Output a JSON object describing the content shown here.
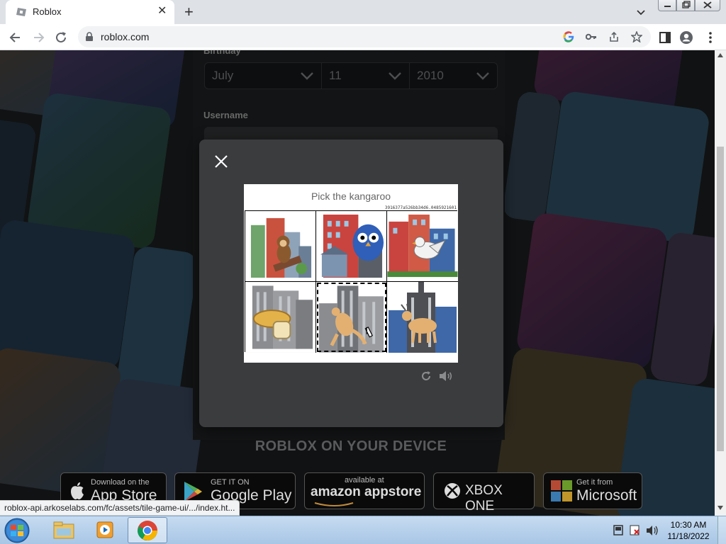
{
  "browser": {
    "tab_title": "Roblox",
    "url": "roblox.com",
    "status_link": "roblox-api.arkoselabs.com/fc/assets/tile-game-ui/.../index.ht..."
  },
  "signup": {
    "birthday_label": "Birthday",
    "birthday_month": "July",
    "birthday_day": "11",
    "birthday_year": "2010",
    "username_label": "Username"
  },
  "captcha": {
    "prompt": "Pick the kangaroo",
    "session_id": "3916377a526bb34d6.0485921601",
    "tiles": [
      {
        "subject": "monkey"
      },
      {
        "subject": "owl"
      },
      {
        "subject": "bird"
      },
      {
        "subject": "bread"
      },
      {
        "subject": "kangaroo",
        "selected": true
      },
      {
        "subject": "goat"
      }
    ]
  },
  "footer": {
    "heading": "ROBLOX ON YOUR DEVICE",
    "apple_small": "Download on the",
    "apple_big": "App Store",
    "google_small": "GET IT ON",
    "google_big": "Google Play",
    "amazon_small": "available at",
    "amazon_big": "amazon appstore",
    "xbox_big": "XBOX ONE",
    "microsoft_small": "Get it from",
    "microsoft_big": "Microsoft"
  },
  "taskbar": {
    "time": "10:30 AM",
    "date": "11/18/2022"
  }
}
